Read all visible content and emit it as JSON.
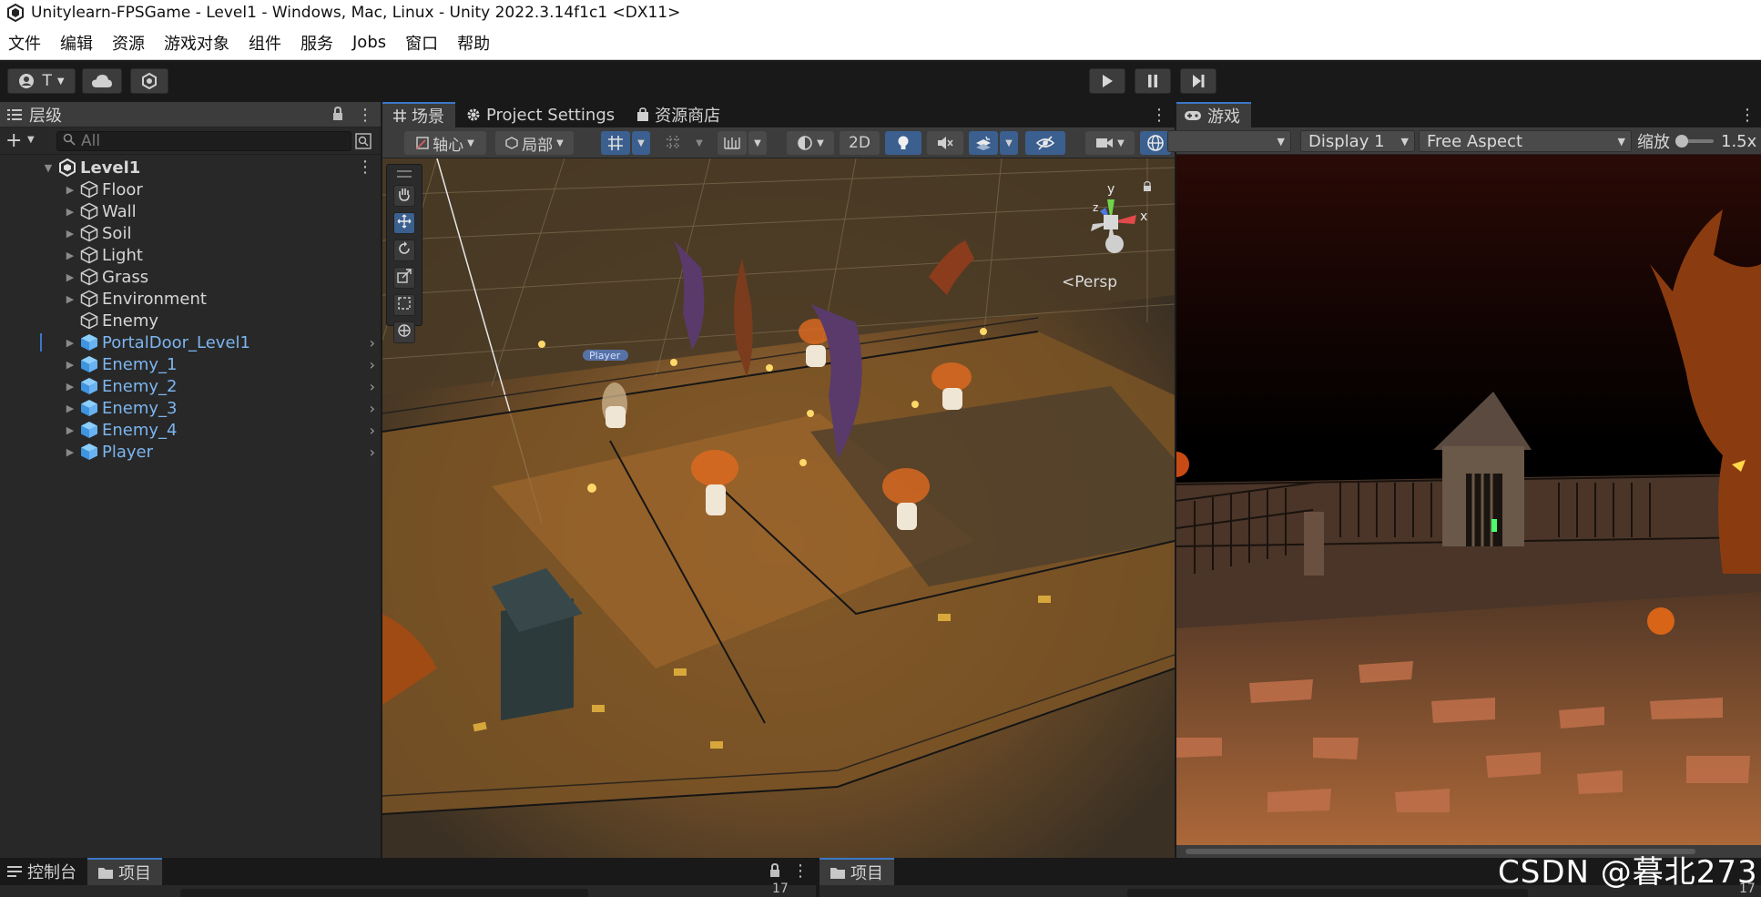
{
  "window": {
    "title": "Unitylearn-FPSGame - Level1 - Windows, Mac, Linux - Unity 2022.3.14f1c1 <DX11>"
  },
  "menu": [
    "文件",
    "编辑",
    "资源",
    "游戏对象",
    "组件",
    "服务",
    "Jobs",
    "窗口",
    "帮助"
  ],
  "toolbar": {
    "account_label": "T"
  },
  "hierarchy": {
    "tab_label": "层级",
    "search_placeholder": "All",
    "scene_name": "Level1",
    "items": [
      {
        "label": "Floor",
        "prefab": false,
        "expandable": true
      },
      {
        "label": "Wall",
        "prefab": false,
        "expandable": true
      },
      {
        "label": "Soil",
        "prefab": false,
        "expandable": true
      },
      {
        "label": "Light",
        "prefab": false,
        "expandable": true
      },
      {
        "label": "Grass",
        "prefab": false,
        "expandable": true
      },
      {
        "label": "Environment",
        "prefab": false,
        "expandable": true
      },
      {
        "label": "Enemy",
        "prefab": false,
        "expandable": false
      },
      {
        "label": "PortalDoor_Level1",
        "prefab": true,
        "expandable": true
      },
      {
        "label": "Enemy_1",
        "prefab": true,
        "expandable": true
      },
      {
        "label": "Enemy_2",
        "prefab": true,
        "expandable": true
      },
      {
        "label": "Enemy_3",
        "prefab": true,
        "expandable": true
      },
      {
        "label": "Enemy_4",
        "prefab": true,
        "expandable": true
      },
      {
        "label": "Player",
        "prefab": true,
        "expandable": true
      }
    ]
  },
  "scene": {
    "tabs": [
      {
        "label": "场景",
        "icon": "grid-icon",
        "active": true
      },
      {
        "label": "Project Settings",
        "icon": "gear-icon",
        "active": false
      },
      {
        "label": "资源商店",
        "icon": "bag-icon",
        "active": false
      }
    ],
    "pivot_label": "轴心",
    "local_label": "局部",
    "mode_2d_label": "2D",
    "persp_label": "Persp",
    "gizmo_axes": {
      "x": "x",
      "y": "y",
      "z": "z"
    },
    "floating_label": "Player"
  },
  "game": {
    "tab_label": "游戏",
    "display_label": "Display 1",
    "aspect_label": "Free Aspect",
    "scale_label": "缩放",
    "scale_value": "1.5x"
  },
  "bottom": {
    "tabs_left": [
      {
        "label": "控制台",
        "icon": "console-icon",
        "active": false
      },
      {
        "label": "项目",
        "icon": "folder-icon",
        "active": true
      }
    ],
    "tabs_right": [
      {
        "label": "项目",
        "icon": "folder-icon",
        "active": true
      }
    ],
    "count_left": "17",
    "count_right": "17"
  },
  "watermark": "CSDN @暮北273",
  "colors": {
    "accent": "#3a78c8",
    "prefab_text": "#7cb5ef",
    "panel": "#282828",
    "tab_active": "#3c3c3c",
    "background": "#191919"
  }
}
